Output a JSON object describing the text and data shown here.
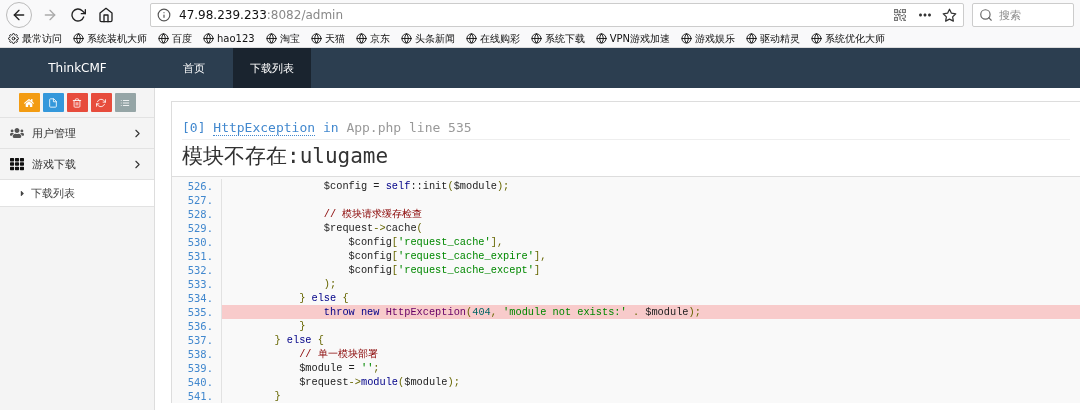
{
  "browser": {
    "address_host": "47.98.239.233",
    "address_rest": ":8082/admin",
    "search_placeholder": "搜索",
    "bookmarks": [
      {
        "label": "最常访问",
        "kind": "settings"
      },
      {
        "label": "系统装机大师",
        "kind": "site"
      },
      {
        "label": "百度",
        "kind": "site"
      },
      {
        "label": "hao123",
        "kind": "site"
      },
      {
        "label": "淘宝",
        "kind": "site"
      },
      {
        "label": "天猫",
        "kind": "site"
      },
      {
        "label": "京东",
        "kind": "site"
      },
      {
        "label": "头条新闻",
        "kind": "site"
      },
      {
        "label": "在线购彩",
        "kind": "site"
      },
      {
        "label": "系统下载",
        "kind": "site"
      },
      {
        "label": "VPN游戏加速",
        "kind": "site"
      },
      {
        "label": "游戏娱乐",
        "kind": "site"
      },
      {
        "label": "驱动精灵",
        "kind": "site"
      },
      {
        "label": "系统优化大师",
        "kind": "site"
      }
    ]
  },
  "navbar": {
    "brand": "ThinkCMF",
    "tabs": [
      {
        "label": "首页",
        "selected": false
      },
      {
        "label": "下载列表",
        "selected": true
      }
    ]
  },
  "sidebar": {
    "tool_buttons": [
      {
        "color": "#f39c12"
      },
      {
        "color": "#3498db"
      },
      {
        "color": "#e74c3c"
      },
      {
        "color": "#e74c3c"
      },
      {
        "color": "#95a5a6"
      }
    ],
    "items": [
      {
        "label": "用户管理"
      },
      {
        "label": "游戏下载",
        "children": [
          {
            "label": "下载列表"
          }
        ]
      }
    ]
  },
  "error": {
    "index": "[0]",
    "exception": "HttpException",
    "in_word": "in",
    "location": "App.php line 535",
    "message": "模块不存在:ulugame",
    "code_lines": [
      {
        "number": "526.",
        "highlighted": false,
        "tokens": [
          {
            "kind": "plain",
            "text": "                $config = "
          },
          {
            "kind": "kw",
            "text": "self"
          },
          {
            "kind": "plain",
            "text": "::init"
          },
          {
            "kind": "punct",
            "text": "("
          },
          {
            "kind": "plain",
            "text": "$module"
          },
          {
            "kind": "punct",
            "text": ");"
          }
        ]
      },
      {
        "number": "527.",
        "highlighted": false
      },
      {
        "number": "528.",
        "highlighted": false,
        "tokens": [
          {
            "kind": "com",
            "text": "                // 模块请求缓存检查"
          }
        ]
      },
      {
        "number": "529.",
        "highlighted": false,
        "tokens": [
          {
            "kind": "plain",
            "text": "                $request"
          },
          {
            "kind": "punct",
            "text": "->"
          },
          {
            "kind": "plain",
            "text": "cache"
          },
          {
            "kind": "punct",
            "text": "("
          }
        ]
      },
      {
        "number": "530.",
        "highlighted": false,
        "tokens": [
          {
            "kind": "plain",
            "text": "                    $config"
          },
          {
            "kind": "punct",
            "text": "["
          },
          {
            "kind": "str",
            "text": "'request_cache'"
          },
          {
            "kind": "punct",
            "text": "],"
          }
        ]
      },
      {
        "number": "531.",
        "highlighted": false,
        "tokens": [
          {
            "kind": "plain",
            "text": "                    $config"
          },
          {
            "kind": "punct",
            "text": "["
          },
          {
            "kind": "str",
            "text": "'request_cache_expire'"
          },
          {
            "kind": "punct",
            "text": "],"
          }
        ]
      },
      {
        "number": "532.",
        "highlighted": false,
        "tokens": [
          {
            "kind": "plain",
            "text": "                    $config"
          },
          {
            "kind": "punct",
            "text": "["
          },
          {
            "kind": "str",
            "text": "'request_cache_except'"
          },
          {
            "kind": "punct",
            "text": "]"
          }
        ]
      },
      {
        "number": "533.",
        "highlighted": false,
        "tokens": [
          {
            "kind": "punct",
            "text": "                );"
          }
        ]
      },
      {
        "number": "534.",
        "highlighted": false,
        "tokens": [
          {
            "kind": "punct",
            "text": "            } "
          },
          {
            "kind": "kw",
            "text": "else "
          },
          {
            "kind": "punct",
            "text": "{"
          }
        ]
      },
      {
        "number": "535.",
        "highlighted": true,
        "tokens": [
          {
            "kind": "kw",
            "text": "                throw new "
          },
          {
            "kind": "type",
            "text": "HttpException"
          },
          {
            "kind": "punct",
            "text": "("
          },
          {
            "kind": "num",
            "text": "404"
          },
          {
            "kind": "punct",
            "text": ", "
          },
          {
            "kind": "str",
            "text": "'module not exists:' "
          },
          {
            "kind": "punct",
            "text": "."
          },
          {
            "kind": "plain",
            "text": " $module"
          },
          {
            "kind": "punct",
            "text": ");"
          }
        ]
      },
      {
        "number": "536.",
        "highlighted": false,
        "tokens": [
          {
            "kind": "punct",
            "text": "            }"
          }
        ]
      },
      {
        "number": "537.",
        "highlighted": false,
        "tokens": [
          {
            "kind": "punct",
            "text": "        } "
          },
          {
            "kind": "kw",
            "text": "else "
          },
          {
            "kind": "punct",
            "text": "{"
          }
        ]
      },
      {
        "number": "538.",
        "highlighted": false,
        "tokens": [
          {
            "kind": "com",
            "text": "            // 单一模块部署"
          }
        ]
      },
      {
        "number": "539.",
        "highlighted": false,
        "tokens": [
          {
            "kind": "plain",
            "text": "            $module = "
          },
          {
            "kind": "str",
            "text": "''"
          },
          {
            "kind": "punct",
            "text": ";"
          }
        ]
      },
      {
        "number": "540.",
        "highlighted": false,
        "tokens": [
          {
            "kind": "plain",
            "text": "            $request"
          },
          {
            "kind": "punct",
            "text": "->"
          },
          {
            "kind": "kw",
            "text": "module"
          },
          {
            "kind": "punct",
            "text": "("
          },
          {
            "kind": "plain",
            "text": "$module"
          },
          {
            "kind": "punct",
            "text": ");"
          }
        ]
      },
      {
        "number": "541.",
        "highlighted": false,
        "tokens": [
          {
            "kind": "punct",
            "text": "        }"
          }
        ]
      }
    ]
  }
}
